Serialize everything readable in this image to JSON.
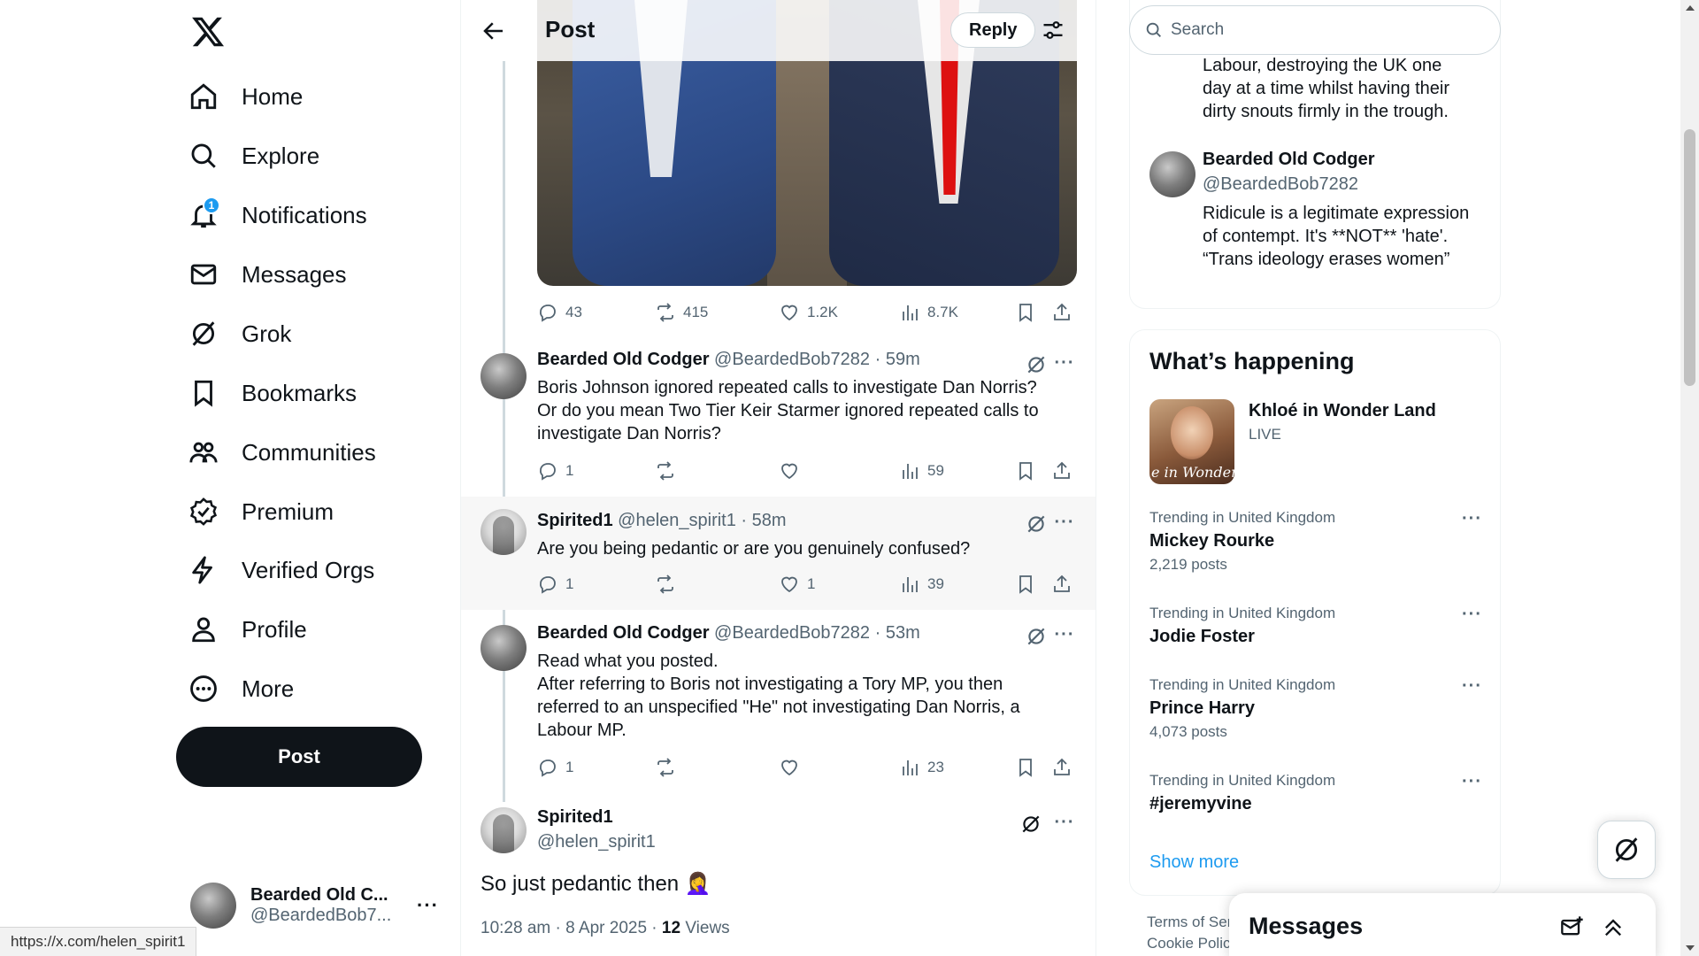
{
  "nav": {
    "items": [
      {
        "label": "Home",
        "icon": "home-icon"
      },
      {
        "label": "Explore",
        "icon": "search-icon"
      },
      {
        "label": "Notifications",
        "icon": "bell-icon",
        "badge": "1"
      },
      {
        "label": "Messages",
        "icon": "envelope-icon"
      },
      {
        "label": "Grok",
        "icon": "grok-icon"
      },
      {
        "label": "Bookmarks",
        "icon": "bookmark-icon"
      },
      {
        "label": "Communities",
        "icon": "people-icon"
      },
      {
        "label": "Premium",
        "icon": "verified-badge-icon"
      },
      {
        "label": "Verified Orgs",
        "icon": "lightning-icon"
      },
      {
        "label": "Profile",
        "icon": "person-icon"
      },
      {
        "label": "More",
        "icon": "more-circle-icon"
      }
    ],
    "post_button": "Post",
    "account": {
      "name": "Bearded Old C...",
      "handle": "@BeardedBob7..."
    }
  },
  "header": {
    "title": "Post",
    "reply_button": "Reply"
  },
  "first_post_stats": {
    "replies": "43",
    "reposts": "415",
    "likes": "1.2K",
    "views": "8.7K"
  },
  "replies": [
    {
      "name": "Bearded Old Codger",
      "handle": "@BeardedBob7282",
      "time": "59m",
      "text": "Boris Johnson ignored repeated calls to investigate Dan Norris?\nOr do you mean Two Tier Keir Starmer ignored repeated calls to investigate Dan Norris?",
      "stats": {
        "replies": "1",
        "reposts": "",
        "likes": "",
        "views": "59"
      }
    },
    {
      "name": "Spirited1",
      "handle": "@helen_spirit1",
      "time": "58m",
      "text": "Are you being pedantic or are you genuinely confused?",
      "stats": {
        "replies": "1",
        "reposts": "",
        "likes": "1",
        "views": "39"
      }
    },
    {
      "name": "Bearded Old Codger",
      "handle": "@BeardedBob7282",
      "time": "53m",
      "text": "Read what you posted.\nAfter referring to Boris not investigating a Tory MP, you then referred to an unspecified \"He\" not investigating Dan Norris, a Labour MP.",
      "stats": {
        "replies": "1",
        "reposts": "",
        "likes": "",
        "views": "23"
      }
    }
  ],
  "focused_post": {
    "name": "Spirited1",
    "handle": "@helen_spirit1",
    "text": "So just pedantic then 🤦‍♀️",
    "timestamp": "10:28 am · 8 Apr 2025 · ",
    "views_count": "12",
    "views_label": " Views"
  },
  "search": {
    "placeholder": "Search"
  },
  "bio_card": {
    "prev_text": "Labour, destroying the UK one\nday at a time whilst having their\ndirty snouts firmly in the trough.",
    "name": "Bearded Old Codger",
    "handle": "@BeardedBob7282",
    "bio": "Ridicule is a legitimate expression of contempt. It's **NOT** 'hate'. “Trans ideology erases women”"
  },
  "whats_happening": {
    "title": "What’s happening",
    "live": {
      "title": "Khloé in Wonder Land",
      "status": "LIVE",
      "thumb_text": "e in Wonder l"
    },
    "trends": [
      {
        "context": "Trending in United Kingdom",
        "topic": "Mickey Rourke",
        "count": "2,219 posts"
      },
      {
        "context": "Trending in United Kingdom",
        "topic": "Jodie Foster",
        "count": ""
      },
      {
        "context": "Trending in United Kingdom",
        "topic": "Prince Harry",
        "count": "4,073 posts"
      },
      {
        "context": "Trending in United Kingdom",
        "topic": "#jeremyvine",
        "count": ""
      }
    ],
    "show_more": "Show more"
  },
  "footer": {
    "line1": "Terms of Ser",
    "line2": "Cookie Polic"
  },
  "messages_drawer": {
    "title": "Messages"
  },
  "status_url": "https://x.com/helen_spirit1",
  "colors": {
    "accent": "#1d9bf0",
    "text": "#0f1419",
    "muted": "#536471",
    "post_button": "#0f1419"
  }
}
